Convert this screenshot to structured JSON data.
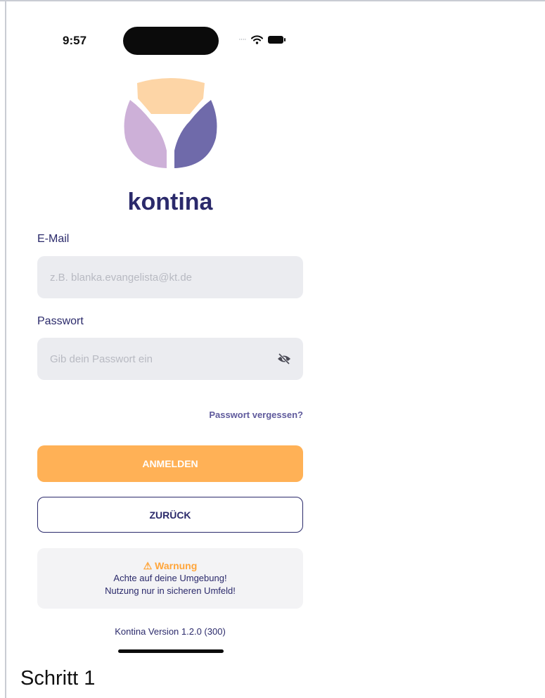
{
  "status_bar": {
    "time": "9:57"
  },
  "app": {
    "brand": "kontina",
    "colors": {
      "primary_text": "#2b2a6b",
      "accent_orange": "#ffb156",
      "warning_orange": "#ffa53a",
      "field_bg": "#ebecf0",
      "logo_peach": "#fdd5a6",
      "logo_lilac": "#cdb0d8",
      "logo_purple": "#6f6aaa"
    }
  },
  "login_form": {
    "email": {
      "label": "E-Mail",
      "placeholder": "z.B. blanka.evangelista@kt.de",
      "value": ""
    },
    "password": {
      "label": "Passwort",
      "placeholder": "Gib dein Passwort ein",
      "value": "",
      "toggle_icon": "eye-slash-icon"
    },
    "forgot_link": "Passwort vergessen?",
    "login_button": "ANMELDEN",
    "back_button": "ZURÜCK"
  },
  "warning": {
    "title": "⚠ Warnung",
    "line1": "Achte auf deine Umgebung!",
    "line2": "Nutzung nur in sicheren Umfeld!"
  },
  "footer": {
    "version": "Kontina Version 1.2.0 (300)"
  },
  "caption": "Schritt 1"
}
